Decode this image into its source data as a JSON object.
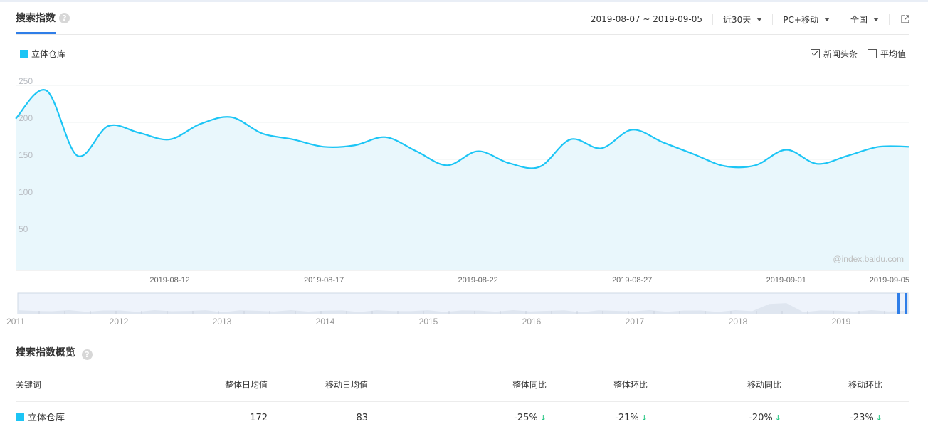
{
  "header": {
    "title": "搜索指数",
    "date_range": "2019-08-07 ~ 2019-09-05",
    "period": "近30天",
    "device": "PC+移动",
    "region": "全国"
  },
  "legend": {
    "series_name": "立体仓库"
  },
  "options": {
    "news_label": "新闻头条",
    "news_checked": true,
    "avg_label": "平均值",
    "avg_checked": false
  },
  "watermark": "@index.baidu.com",
  "chart_data": {
    "type": "area",
    "x": [
      "2019-08-07",
      "2019-08-08",
      "2019-08-09",
      "2019-08-10",
      "2019-08-11",
      "2019-08-12",
      "2019-08-13",
      "2019-08-14",
      "2019-08-15",
      "2019-08-16",
      "2019-08-17",
      "2019-08-18",
      "2019-08-19",
      "2019-08-20",
      "2019-08-21",
      "2019-08-22",
      "2019-08-23",
      "2019-08-24",
      "2019-08-25",
      "2019-08-26",
      "2019-08-27",
      "2019-08-28",
      "2019-08-29",
      "2019-08-30",
      "2019-08-31",
      "2019-09-01",
      "2019-09-02",
      "2019-09-03",
      "2019-09-04",
      "2019-09-05"
    ],
    "series": [
      {
        "name": "立体仓库",
        "color": "#1cc5f5",
        "values": [
          205,
          243,
          155,
          195,
          186,
          177,
          198,
          207,
          185,
          177,
          167,
          169,
          180,
          161,
          142,
          161,
          145,
          140,
          177,
          165,
          190,
          173,
          157,
          141,
          142,
          163,
          144,
          155,
          167,
          167
        ]
      }
    ],
    "yticks": [
      50,
      100,
      150,
      200,
      250
    ],
    "ylim": [
      0,
      250
    ],
    "xticks": [
      "2019-08-12",
      "2019-08-17",
      "2019-08-22",
      "2019-08-27",
      "2019-09-01",
      "2019-09-05"
    ],
    "overview_years": [
      "2011",
      "2012",
      "2013",
      "2014",
      "2015",
      "2016",
      "2017",
      "2018",
      "2019"
    ]
  },
  "overview": {
    "title": "搜索指数概览",
    "headers": [
      "关键词",
      "整体日均值",
      "移动日均值",
      "整体同比",
      "整体环比",
      "移动同比",
      "移动环比"
    ],
    "row": {
      "keyword": "立体仓库",
      "overall_avg": "172",
      "mobile_avg": "83",
      "overall_yoy": "-25%",
      "overall_mom": "-21%",
      "mobile_yoy": "-20%",
      "mobile_mom": "-23%"
    },
    "down_arrow": "↓"
  }
}
